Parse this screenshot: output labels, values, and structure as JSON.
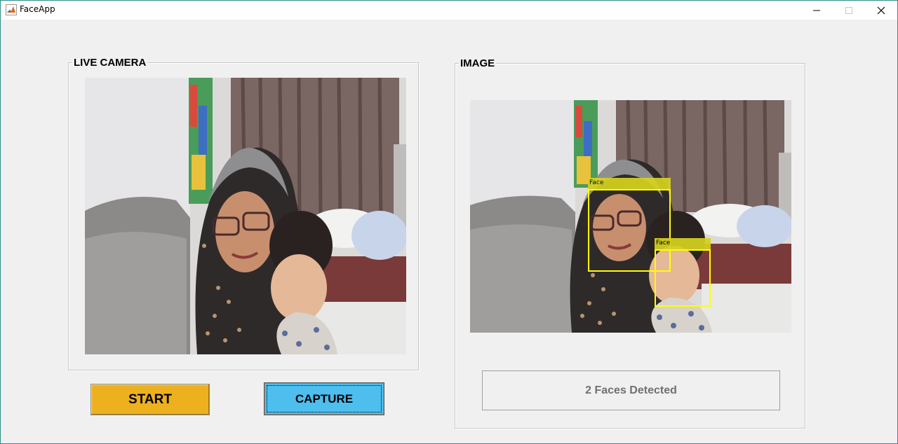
{
  "window": {
    "title": "FaceApp",
    "controls": {
      "minimize_icon": "minimize-icon",
      "maximize_icon": "maximize-icon",
      "close_icon": "close-icon"
    }
  },
  "live_panel": {
    "title": "LIVE CAMERA"
  },
  "image_panel": {
    "title": "IMAGE",
    "detections": [
      {
        "label": "Face"
      },
      {
        "label": "Face"
      }
    ],
    "status": "2 Faces Detected"
  },
  "buttons": {
    "start_label": "START",
    "capture_label": "CAPTURE"
  },
  "colors": {
    "start_button": "#edb120",
    "capture_button": "#4dbeee",
    "detection_box": "#ffff00",
    "detection_label_bg": "#d6d21e",
    "window_border": "#2b8f87"
  }
}
